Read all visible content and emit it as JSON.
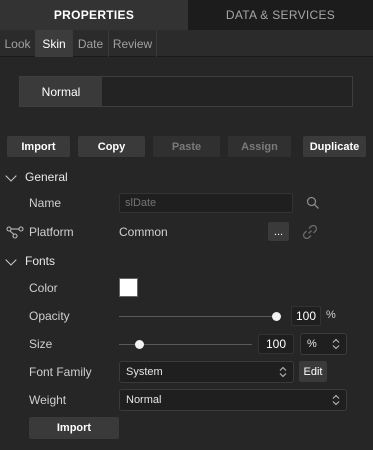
{
  "top_tabs": {
    "properties": "PROPERTIES",
    "data_services": "DATA & SERVICES"
  },
  "sub_tabs": [
    "Look",
    "Skin",
    "Date",
    "Review"
  ],
  "state": {
    "normal": "Normal"
  },
  "actions": {
    "import": "Import",
    "copy": "Copy",
    "paste": "Paste",
    "assign": "Assign",
    "duplicate": "Duplicate"
  },
  "general": {
    "header": "General",
    "name_label": "Name",
    "name_placeholder": "slDate",
    "platform_label": "Platform",
    "platform_value": "Common",
    "more": "..."
  },
  "fonts": {
    "header": "Fonts",
    "color_label": "Color",
    "color_value": "#ffffff",
    "opacity_label": "Opacity",
    "opacity_value": "100",
    "opacity_unit": "%",
    "size_label": "Size",
    "size_value": "100",
    "size_unit": "%",
    "family_label": "Font Family",
    "family_value": "System",
    "edit": "Edit",
    "weight_label": "Weight",
    "weight_value": "Normal",
    "import": "Import"
  }
}
